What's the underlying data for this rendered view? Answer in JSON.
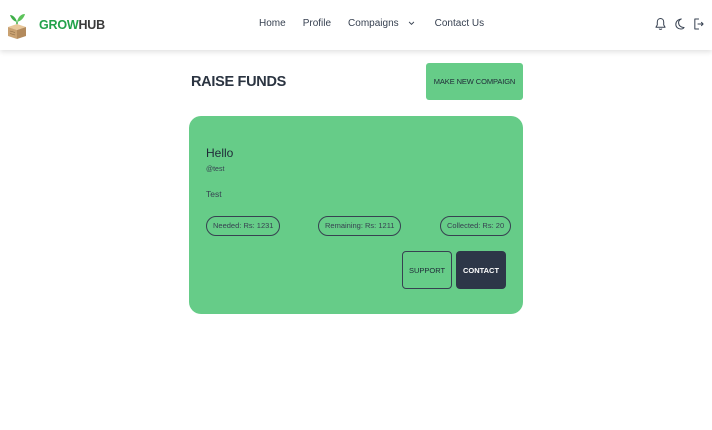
{
  "brand": {
    "name_part1": "GROW",
    "name_part2": "HUB"
  },
  "nav": {
    "home": "Home",
    "profile": "Profile",
    "campaigns": "Compaigns",
    "contact": "Contact Us"
  },
  "header": {
    "title": "RAISE FUNDS",
    "new_campaign_label": "MAKE NEW COMPAIGN"
  },
  "campaign": {
    "title": "Hello",
    "handle": "@test",
    "description": "Test",
    "needed": "Needed: Rs: 1231",
    "remaining": "Remaining: Rs: 1211",
    "collected": "Collected: Rs: 20",
    "support_label": "SUPPORT",
    "contact_label": "CONTACT"
  },
  "colors": {
    "accent": "#66cc88",
    "brand_green": "#22a24a",
    "dark_button": "#2d3748"
  },
  "icons": [
    "bell-icon",
    "moon-icon",
    "logout-icon",
    "chevron-down-icon",
    "growhub-logo-icon"
  ]
}
